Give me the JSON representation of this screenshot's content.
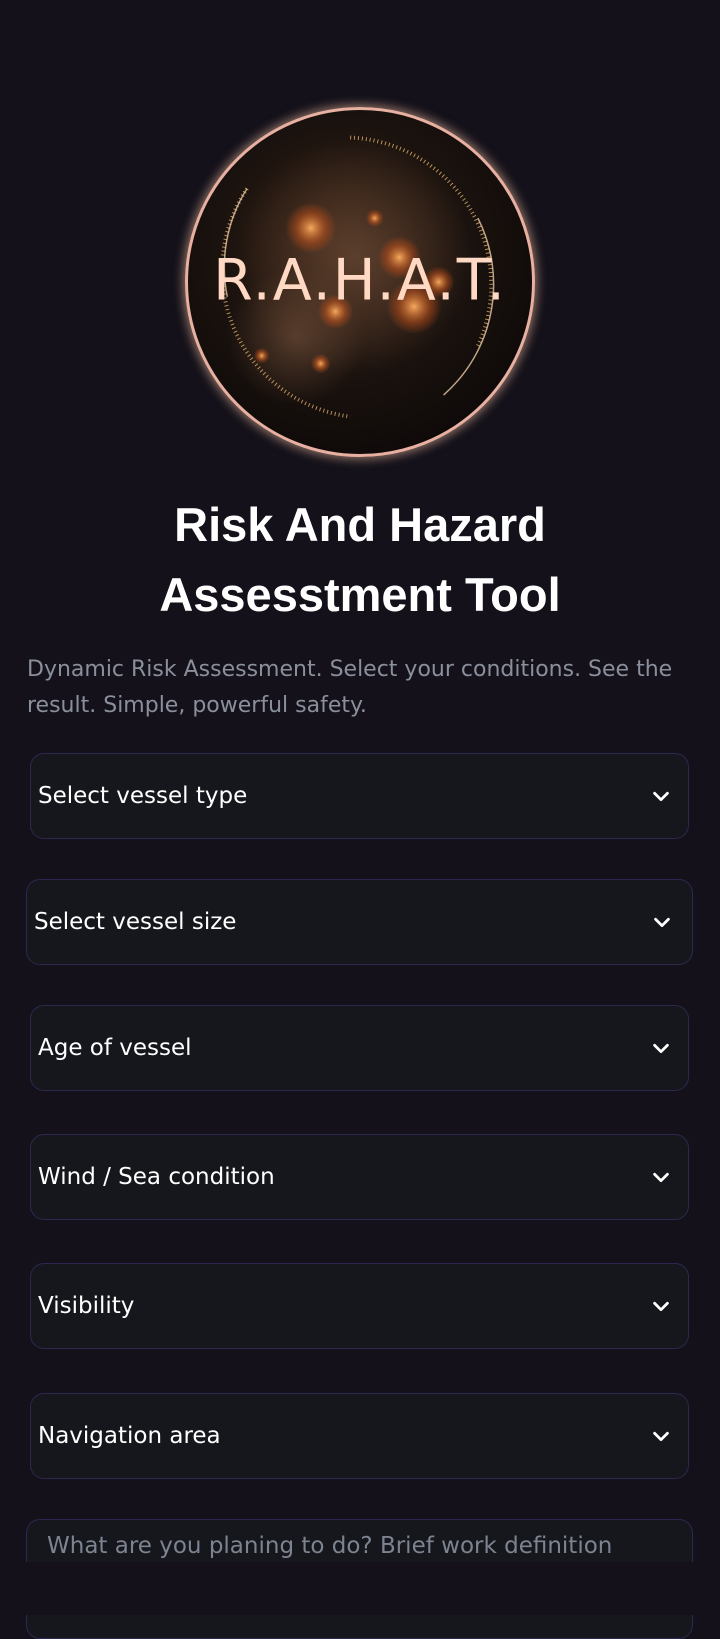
{
  "logo": {
    "text": "R.A.H.A.T."
  },
  "header": {
    "title_line1": "Risk And Hazard",
    "title_line2": "Assesstment Tool",
    "subtitle": "Dynamic Risk Assessment. Select your conditions. See the result. Simple, powerful safety."
  },
  "form": {
    "vessel_type": "Select vessel type",
    "vessel_size": "Select vessel size",
    "vessel_age": "Age of vessel",
    "wind_sea": "Wind / Sea condition",
    "visibility": "Visibility",
    "navigation_area": "Navigation area",
    "work_definition_placeholder": "What are you planing to do? Brief work definition"
  },
  "colors": {
    "background": "#14111a",
    "field_background": "#15171c",
    "field_border": "#2c2850",
    "logo_ring": "#e8b0a0",
    "subtitle_text": "#8a8f9c"
  },
  "icons": {
    "select_chevron": "chevron-down-icon"
  }
}
